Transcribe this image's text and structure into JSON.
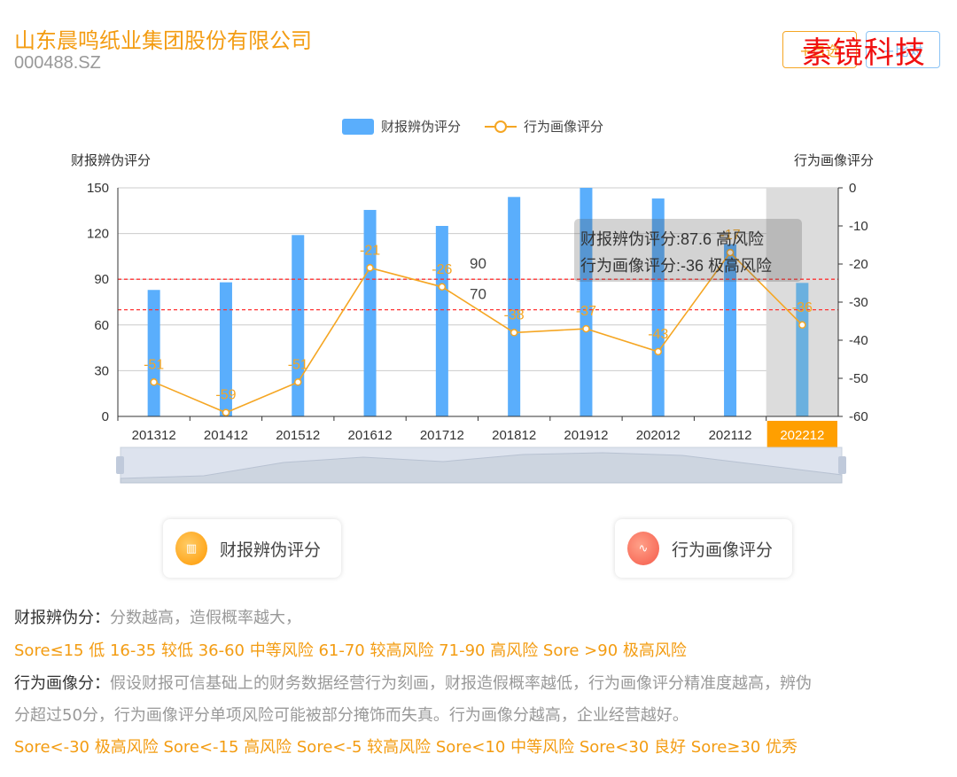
{
  "header": {
    "company": "山东晨鸣纸业集团股份有限公司",
    "code": "000488.SZ",
    "btn_add": "+自选",
    "btn_compare": "+比对",
    "watermark": "素镜科技"
  },
  "chart_data": {
    "type": "bar",
    "categories": [
      "201312",
      "201412",
      "201512",
      "201612",
      "201712",
      "201812",
      "201912",
      "202012",
      "202112",
      "202212"
    ],
    "series": [
      {
        "name": "财报辨伪评分",
        "type": "bar",
        "axis": "left",
        "values": [
          83,
          88,
          119,
          135.5,
          125,
          144,
          150,
          143,
          113,
          87.6
        ],
        "color": "#5aaefc"
      },
      {
        "name": "行为画像评分",
        "type": "line",
        "axis": "right",
        "values": [
          -51,
          -59,
          -51,
          -21,
          -26,
          -38,
          -37,
          -43,
          -17,
          -36
        ],
        "color": "#f5a623"
      }
    ],
    "ylabel_left": "财报辨伪评分",
    "ylabel_right": "行为画像评分",
    "ylim_left": [
      0,
      150
    ],
    "yticks_left": [
      0,
      30,
      60,
      90,
      120,
      150
    ],
    "ylim_right": [
      -60,
      0
    ],
    "yticks_right": [
      0,
      -10,
      -20,
      -30,
      -40,
      -50,
      -60
    ],
    "threshold_lines": [
      90,
      70
    ],
    "selected": "202212",
    "tooltip": [
      "财报辨伪评分:87.6 高风险",
      "行为画像评分:-36 极高风险"
    ],
    "legend_position": "top-center"
  },
  "cards": {
    "financial": "财报辨伪评分",
    "behavior": "行为画像评分"
  },
  "notes": {
    "fin_label": "财报辨伪分：",
    "fin_desc": "分数越高，造假概率越大，",
    "fin_scale": "Sore≤15 低 16-35 较低 36-60 中等风险 61-70 较高风险 71-90 高风险 Sore >90 极高风险",
    "beh_label": "行为画像分：",
    "beh_desc1": "假设财报可信基础上的财务数据经营行为刻画，财报造假概率越低，行为画像评分精准度越高，辨伪",
    "beh_desc2": "分超过50分，行为画像评分单项风险可能被部分掩饰而失真。行为画像分越高，企业经营越好。",
    "beh_scale": "Sore<-30 极高风险 Sore<-15 高风险 Sore<-5 较高风险 Sore<10 中等风险 Sore<30 良好 Sore≥30 优秀"
  }
}
